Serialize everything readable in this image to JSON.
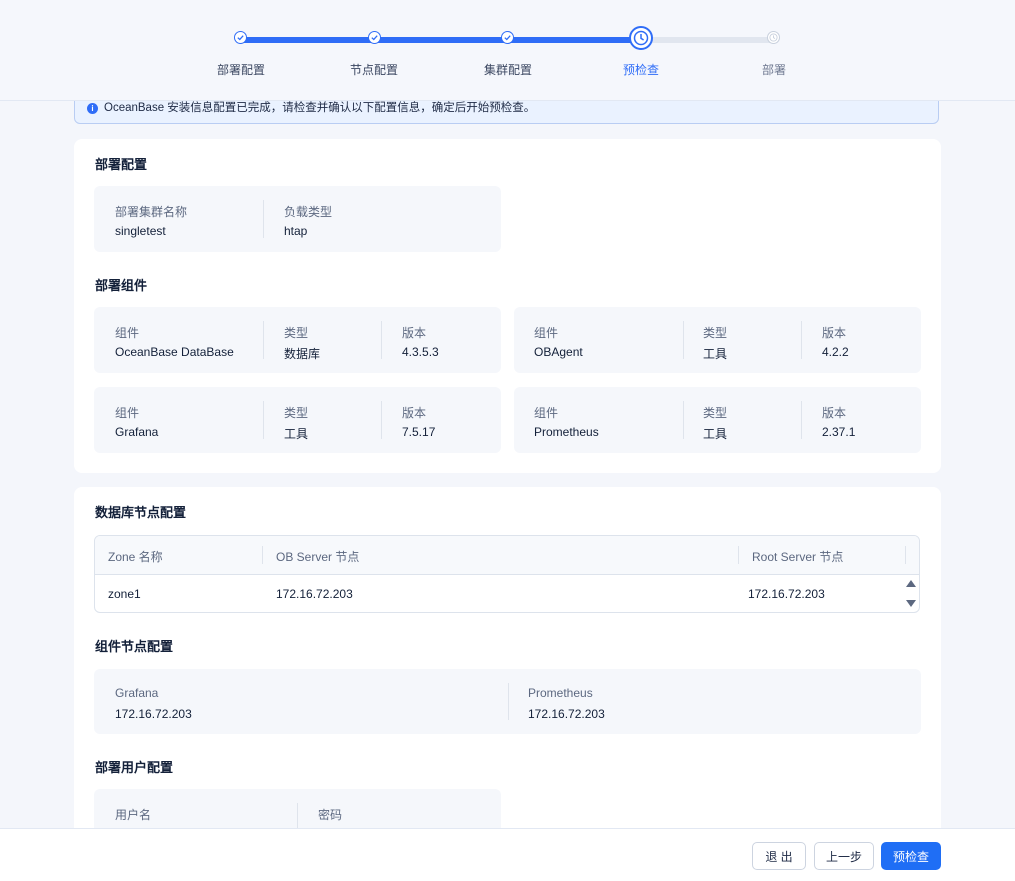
{
  "steps": [
    {
      "label": "部署配置",
      "state": "done"
    },
    {
      "label": "节点配置",
      "state": "done"
    },
    {
      "label": "集群配置",
      "state": "done"
    },
    {
      "label": "预检查",
      "state": "current"
    },
    {
      "label": "部署",
      "state": "todo"
    }
  ],
  "notice": {
    "text": "OceanBase 安装信息配置已完成，请检查并确认以下配置信息，确定后开始预检查。"
  },
  "deploy_config": {
    "title": "部署配置",
    "cluster_name_label": "部署集群名称",
    "cluster_name": "singletest",
    "load_type_label": "负载类型",
    "load_type": "htap"
  },
  "components": {
    "title": "部署组件",
    "component_label": "组件",
    "type_label": "类型",
    "version_label": "版本",
    "items": [
      {
        "name": "OceanBase DataBase",
        "type": "数据库",
        "version": "4.3.5.3"
      },
      {
        "name": "OBAgent",
        "type": "工具",
        "version": "4.2.2"
      },
      {
        "name": "Grafana",
        "type": "工具",
        "version": "7.5.17"
      },
      {
        "name": "Prometheus",
        "type": "工具",
        "version": "2.37.1"
      }
    ]
  },
  "db_nodes": {
    "title": "数据库节点配置",
    "columns": [
      "Zone 名称",
      "OB Server 节点",
      "Root Server 节点"
    ],
    "rows": [
      [
        "zone1",
        "172.16.72.203",
        "172.16.72.203"
      ]
    ]
  },
  "component_nodes": {
    "title": "组件节点配置",
    "items": [
      {
        "name": "Grafana",
        "ip": "172.16.72.203"
      },
      {
        "name": "Prometheus",
        "ip": "172.16.72.203"
      }
    ]
  },
  "user_config": {
    "title": "部署用户配置",
    "username_label": "用户名",
    "password_label": "密码"
  },
  "footer": {
    "exit": "退 出",
    "prev": "上一步",
    "precheck": "预检查"
  },
  "colors": {
    "accent": "#1f6ef5",
    "background": "#f4f6fb",
    "card": "#ffffff",
    "info_bg": "#eaf2ff"
  }
}
